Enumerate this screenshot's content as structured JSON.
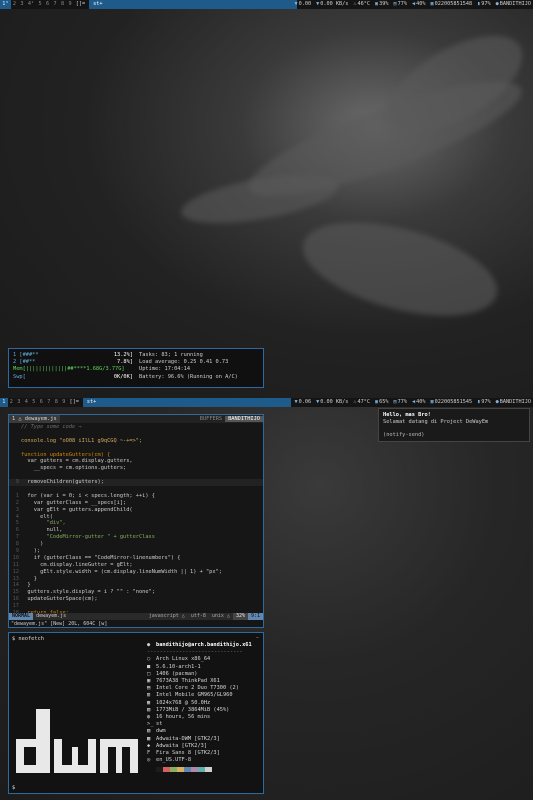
{
  "top_bar": {
    "workspaces": [
      "1",
      "2",
      "3",
      "4",
      "5",
      "6",
      "7",
      "8",
      "9"
    ],
    "active_workspace": "1",
    "workspace_marks": {
      "1": "³",
      "4": "¹"
    },
    "layout": "[]=",
    "window_title": "st+",
    "status": {
      "load": "0.00",
      "net": "0.00 KB/s",
      "temp": "46°C",
      "cpu": "39%",
      "mem": "77%",
      "vol": "40%",
      "date": "022005851548",
      "battery": "97%",
      "user": "BANDITHIJO"
    }
  },
  "bottom_bar": {
    "workspaces": [
      "1",
      "2",
      "3",
      "4",
      "5",
      "6",
      "7",
      "8",
      "9"
    ],
    "active_workspace": "1",
    "layout": "[]=",
    "window_title": "st+",
    "status": {
      "load": "0.06",
      "net": "0.00 KB/s",
      "temp": "47°C",
      "cpu": "65%",
      "mem": "77%",
      "vol": "40%",
      "date": "022005851545",
      "battery": "97%",
      "user": "BANDITHIJO"
    }
  },
  "htop": {
    "cpu1_label": "1  [###**",
    "cpu1_pct": "13.2%]",
    "cpu2_label": "2  [##**",
    "cpu2_pct": "7.8%]",
    "mem_label": "Mem[|||||||||||||##****1.68G/3.77G]",
    "swp_label": "Swp[",
    "swp_val": "0K/0K]",
    "tasks": "Tasks: 83; 1 running",
    "load": "Load average: 0.25 0.41 0.73",
    "uptime": "Uptime: 17:04:14",
    "battery": "Battery: 96.6% (Running on A/C)"
  },
  "editor": {
    "tab": "1 △ dewayem.js",
    "buffers": "BUFFERS",
    "user": "BANDITHIJO",
    "mode": "NORMAL",
    "file": "dewayem.js",
    "filetype": "javascript △",
    "encoding": "utf-8",
    "format": "unix △",
    "percent": "32%",
    "position": "9:1",
    "message": "\"dewayem.js\" [New] 20L, 604C [w]",
    "lines": [
      {
        "n": "",
        "t": "// Type some code →",
        "c": "cm"
      },
      {
        "n": "",
        "t": "",
        "c": ""
      },
      {
        "n": "",
        "t": "console.log \"oO08 iIlL1 g9qCGQ ~-+=>\";",
        "c": "fn"
      },
      {
        "n": "",
        "t": "",
        "c": ""
      },
      {
        "n": "",
        "t": "function updateGutters(cm) {",
        "c": "kw"
      },
      {
        "n": "",
        "t": "  var gutters = cm.display.gutters,",
        "c": ""
      },
      {
        "n": "",
        "t": "    __specs = cm.options.gutters;",
        "c": ""
      },
      {
        "n": "",
        "t": "",
        "c": ""
      },
      {
        "n": "9",
        "t": "  removeChildren(gutters);",
        "c": "cur"
      },
      {
        "n": "",
        "t": "",
        "c": ""
      },
      {
        "n": "1",
        "t": "  for (var i = 0; i < specs.length; ++i) {",
        "c": ""
      },
      {
        "n": "2",
        "t": "    var gutterClass = __specs[i];",
        "c": ""
      },
      {
        "n": "3",
        "t": "    var gElt = gutters.appendChild(",
        "c": ""
      },
      {
        "n": "4",
        "t": "      elt(",
        "c": ""
      },
      {
        "n": "5",
        "t": "        \"div\",",
        "c": "str"
      },
      {
        "n": "6",
        "t": "        null,",
        "c": ""
      },
      {
        "n": "7",
        "t": "        \"CodeMirror-gutter \" + gutterClass",
        "c": "str"
      },
      {
        "n": "8",
        "t": "      )",
        "c": ""
      },
      {
        "n": "9",
        "t": "    );",
        "c": ""
      },
      {
        "n": "10",
        "t": "    if (gutterClass == \"CodeMirror-linenumbers\") {",
        "c": ""
      },
      {
        "n": "11",
        "t": "      cm.display.lineGutter = gElt;",
        "c": ""
      },
      {
        "n": "12",
        "t": "      gElt.style.width = (cm.display.lineNumWidth || 1) + \"px\";",
        "c": ""
      },
      {
        "n": "13",
        "t": "    }",
        "c": ""
      },
      {
        "n": "14",
        "t": "  }",
        "c": ""
      },
      {
        "n": "15",
        "t": "  gutters.style.display = i ? \"\" : \"none\";",
        "c": ""
      },
      {
        "n": "16",
        "t": "  updateGutterSpace(cm);",
        "c": ""
      },
      {
        "n": "17",
        "t": "",
        "c": ""
      },
      {
        "n": "18",
        "t": "  return false;",
        "c": "kw"
      }
    ]
  },
  "neofetch": {
    "command": "$ neofetch",
    "scroll": "−",
    "header": "bandithijo@arch.bandithijo.x61",
    "separator": "------------------------------",
    "rows": [
      {
        "icon": "○",
        "text": "Arch Linux x86_64"
      },
      {
        "icon": "■",
        "text": "5.6.10-arch1-1"
      },
      {
        "icon": "□",
        "text": "1406 (pacman)"
      },
      {
        "icon": "▣",
        "text": "7673A38 ThinkPad X61"
      },
      {
        "icon": "▤",
        "text": "Intel Core 2 Duo T7300 (2)"
      },
      {
        "icon": "▥",
        "text": "Intel Mobile GM965/GL960"
      },
      {
        "icon": "▦",
        "text": "1024x768 @ 50.0Hz"
      },
      {
        "icon": "▧",
        "text": "1773MiB / 3864MiB (45%)"
      },
      {
        "icon": "◍",
        "text": "16 hours, 56 mins"
      },
      {
        "icon": ">_",
        "text": "st"
      },
      {
        "icon": "▨",
        "text": "dwm"
      },
      {
        "icon": "▩",
        "text": "Adwaita-DWM [GTK2/3]"
      },
      {
        "icon": "◆",
        "text": "Adwaita [GTK2/3]"
      },
      {
        "icon": "F",
        "text": "Fira Sans 8 [GTK2/3]"
      },
      {
        "icon": "◎",
        "text": "en_US.UTF-8"
      }
    ],
    "palette": [
      "#1c1c1c",
      "#d75f5f",
      "#87af5f",
      "#d7af5f",
      "#5f87af",
      "#af87af",
      "#5fafaf",
      "#cfcfcf"
    ],
    "bottom_prompt": "$"
  },
  "notification": {
    "title": "Hello, mas Bro!",
    "body": "Selamat datang di Project DeWayEm",
    "app": "(notify-send)"
  },
  "icons": {
    "down": "down-arrow-icon",
    "temp": "thermometer-icon",
    "cpu": "cpu-icon",
    "mem": "memory-icon",
    "vol": "volume-icon",
    "date": "calendar-icon",
    "bat": "battery-icon",
    "user": "user-icon"
  }
}
